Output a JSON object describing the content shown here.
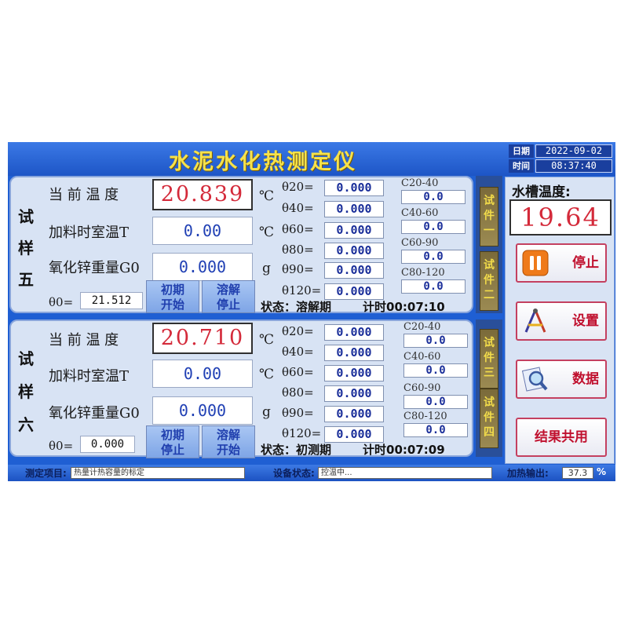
{
  "title": "水泥水化热测定仪",
  "datetime": {
    "date_label": "日期",
    "date": "2022-09-02",
    "time_label": "时间",
    "time": "08:37:40"
  },
  "labels": {
    "current_temp": "当 前 温 度",
    "room_temp": "加料时室温T",
    "zno_weight": "氧化锌重量G0",
    "celsius": "℃",
    "gram": "g",
    "theta0": "θ0=",
    "status_prefix": "状态：",
    "timer_prefix": "计时"
  },
  "theta_labels": [
    "θ20=",
    "θ40=",
    "θ60=",
    "θ80=",
    "θ90=",
    "θ120="
  ],
  "c_labels": [
    "C20-40",
    "C40-60",
    "C60-90",
    "C80-120"
  ],
  "samples": [
    {
      "name": [
        "试",
        "样",
        "五"
      ],
      "current_temp": "20.839",
      "room_temp": "0.00",
      "zno_weight": "0.000",
      "theta0": "21.512",
      "button1": "初期\n开始",
      "button2": "溶解\n停止",
      "theta_values": [
        "0.000",
        "0.000",
        "0.000",
        "0.000",
        "0.000",
        "0.000"
      ],
      "c_values": [
        "0.0",
        "0.0",
        "0.0",
        "0.0"
      ],
      "status": "溶解期",
      "timer": "00:07:10"
    },
    {
      "name": [
        "试",
        "样",
        "六"
      ],
      "current_temp": "20.710",
      "room_temp": "0.00",
      "zno_weight": "0.000",
      "theta0": "0.000",
      "button1": "初期\n停止",
      "button2": "溶解\n开始",
      "theta_values": [
        "0.000",
        "0.000",
        "0.000",
        "0.000",
        "0.000",
        "0.000"
      ],
      "c_values": [
        "0.0",
        "0.0",
        "0.0",
        "0.0"
      ],
      "status": "初测期",
      "timer": "00:07:09"
    }
  ],
  "pieces": [
    "试件一",
    "试件二",
    "试件三",
    "试件四"
  ],
  "water_tank": {
    "label": "水槽温度:",
    "value": "19.64"
  },
  "side_buttons": {
    "stop": "停止",
    "settings": "设置",
    "data": "数据",
    "share": "结果共用"
  },
  "bottom": {
    "project_label": "测定项目:",
    "project_value": "热量计热容量的标定",
    "device_label": "设备状态:",
    "device_value": "控温中...",
    "heat_label": "加热输出:",
    "heat_value": "37.3",
    "heat_unit": "%"
  },
  "colors": {
    "background": "#1f5fd3",
    "title": "#f6e24a",
    "temp_value": "#d42a3a",
    "field_text": "#1f3fb4",
    "accent_red": "#c0102e"
  }
}
